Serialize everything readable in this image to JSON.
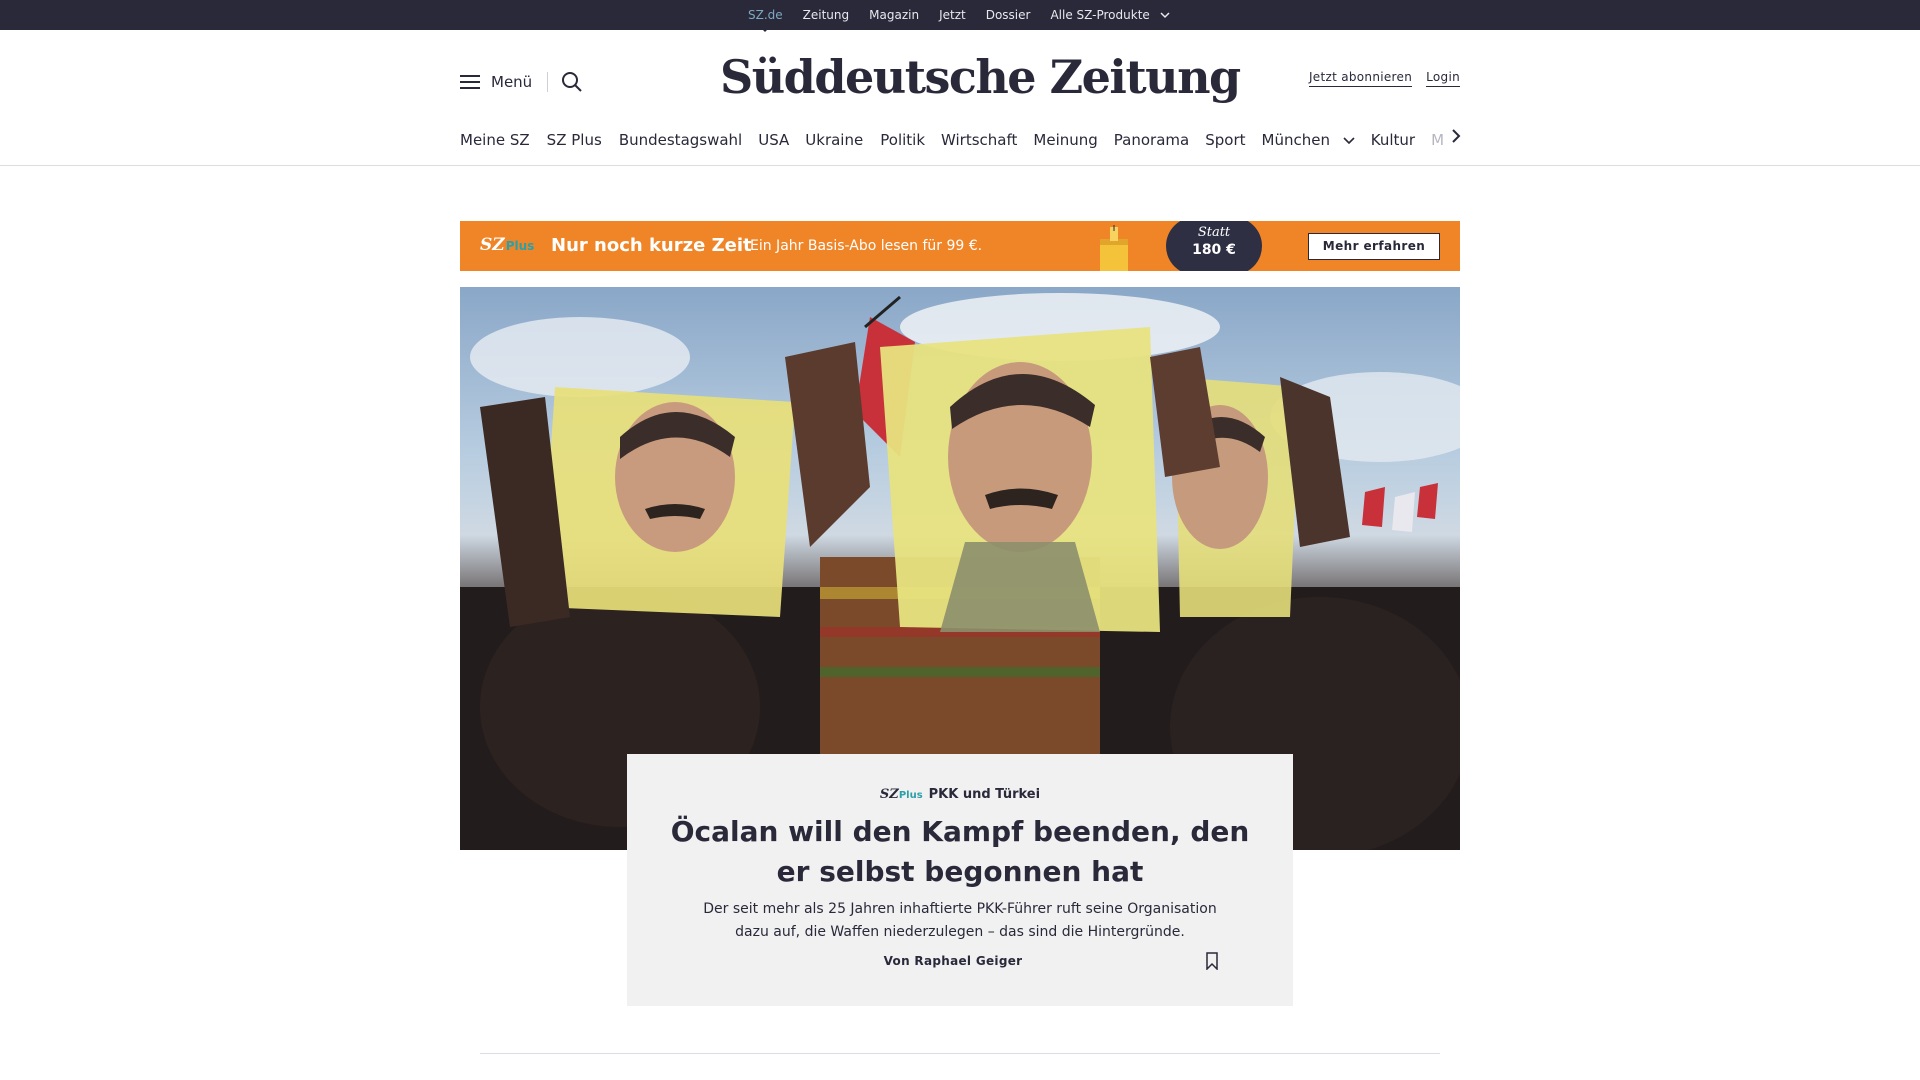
{
  "topbar": {
    "links": [
      "SZ.de",
      "Zeitung",
      "Magazin",
      "Jetzt",
      "Dossier",
      "Alle SZ-Produkte"
    ]
  },
  "header": {
    "menu_label": "Menü",
    "logo_text": "Süddeutsche Zeitung",
    "subscribe_label": "Jetzt abonnieren",
    "login_label": "Login"
  },
  "nav": {
    "items": [
      "Meine SZ",
      "SZ Plus",
      "Bundestagswahl",
      "USA",
      "Ukraine",
      "Politik",
      "Wirtschaft",
      "Meinung",
      "Panorama",
      "Sport",
      "München",
      "Kultur",
      "M"
    ]
  },
  "promo": {
    "logo": "SZ",
    "logo_plus": "Plus",
    "headline": "Nur noch kurze Zeit",
    "text": "Ein Jahr Basis-Abo lesen für 99 €.",
    "statt": "Statt",
    "old_price": "180 €",
    "cta": "Mehr erfahren",
    "color": "#f08528"
  },
  "teaser": {
    "kicker_logo": "SZ",
    "kicker_plus": "Plus",
    "kicker": "PKK und Türkei",
    "title": "Öcalan will den Kampf beenden, den er selbst begonnen hat",
    "dek": "Der seit mehr als 25 Jahren inhaftierte PKK-Führer ruft seine Organisation dazu auf, die Waffen niederzulegen – das sind die Hintergründe.",
    "byline": "Von Raphael Geiger"
  },
  "colors": {
    "dark": "#29293a",
    "teal": "#2ba0a8",
    "orange": "#f08528",
    "card": "#f1f1f2"
  }
}
